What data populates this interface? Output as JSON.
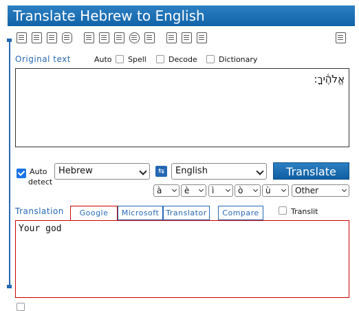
{
  "title": "Translate Hebrew to English",
  "toolbar_icons": [
    "new-document-icon",
    "print-icon",
    "clear-icon",
    "delete-icon",
    "book-icon",
    "spellcheck-icon",
    "keyboard-icon",
    "tools-icon",
    "speaker-icon",
    "printer-icon",
    "image-icon",
    "help-icon",
    "edit-icon"
  ],
  "original": {
    "label": "Original text",
    "auto_label": "Auto",
    "spell_label": "Spell",
    "decode_label": "Decode",
    "dictionary_label": "Dictionary",
    "text": "אֱלֹהֶ֫יךָ:"
  },
  "controls": {
    "auto_detect_line1": "Auto",
    "auto_detect_line2": "detect",
    "source_lang": "Hebrew",
    "target_lang": "English",
    "translate_label": "Translate",
    "accents": [
      "à",
      "è",
      "ì",
      "ò",
      "ù"
    ],
    "other_label": "Other",
    "colors": {
      "accent": "#1a73e8",
      "button": "#1163a8",
      "tab_border": "#cc0000"
    }
  },
  "result": {
    "translation_label": "Translation",
    "tabs": [
      "Google",
      "Microsoft",
      "Translator",
      "Compare"
    ],
    "translit_label": "Translit",
    "text": "Your god"
  }
}
